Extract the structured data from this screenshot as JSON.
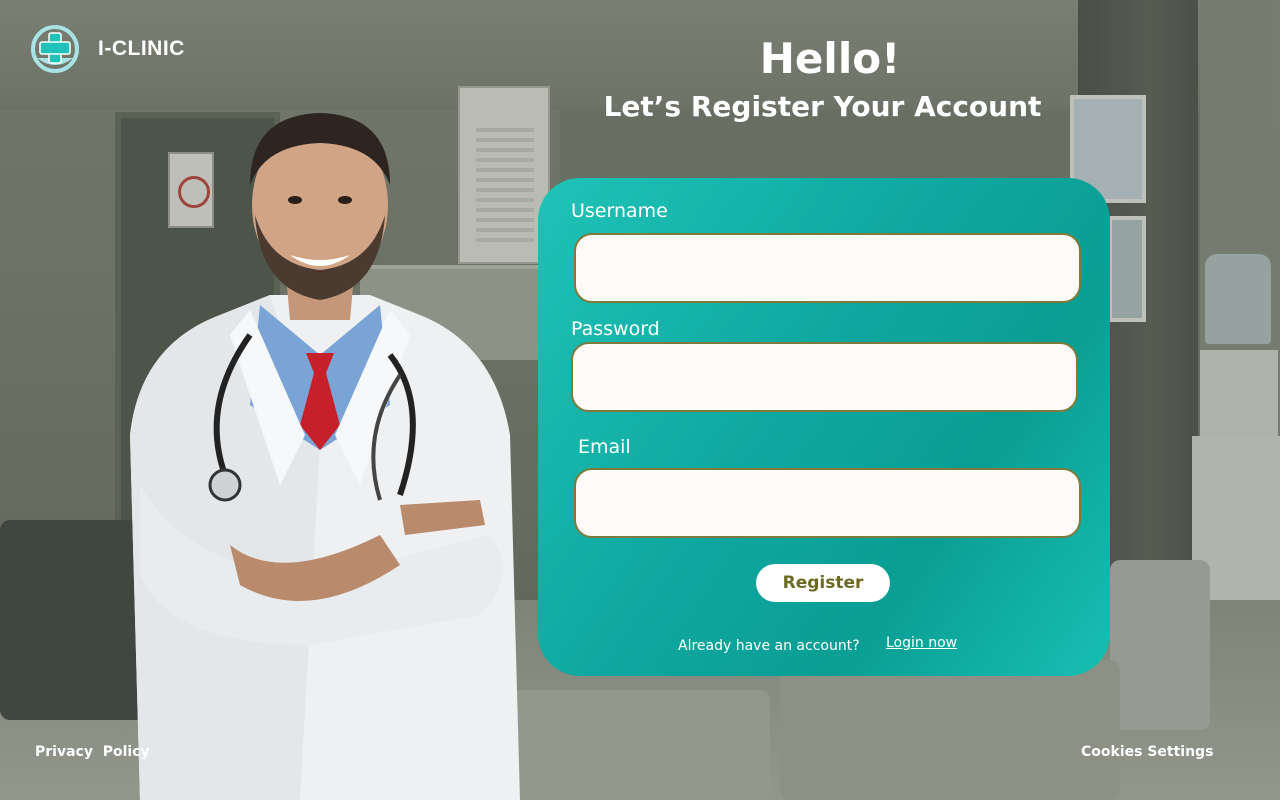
{
  "brand": {
    "name": "I-CLINIC",
    "logo_icon": "medical-cross-icon",
    "logo_ring_color": "#a8e3e6",
    "logo_cross_color": "#1fc3b7"
  },
  "heading": {
    "title": "Hello!",
    "subtitle": "Let’s Register Your Account"
  },
  "form": {
    "username_label": "Username",
    "username_value": "",
    "password_label": "Password",
    "password_value": "",
    "email_label": "Email",
    "email_value": "",
    "register_label": "Register",
    "already_text": "Already have an account?",
    "login_link": "Login now"
  },
  "footer": {
    "privacy": "Privacy  Policy",
    "cookies": "Cookies Settings"
  },
  "colors": {
    "accent": "#0ea79f",
    "accent_light": "#1fc3b7",
    "button_text": "#6d6a22",
    "input_border": "#7d7a3a"
  }
}
